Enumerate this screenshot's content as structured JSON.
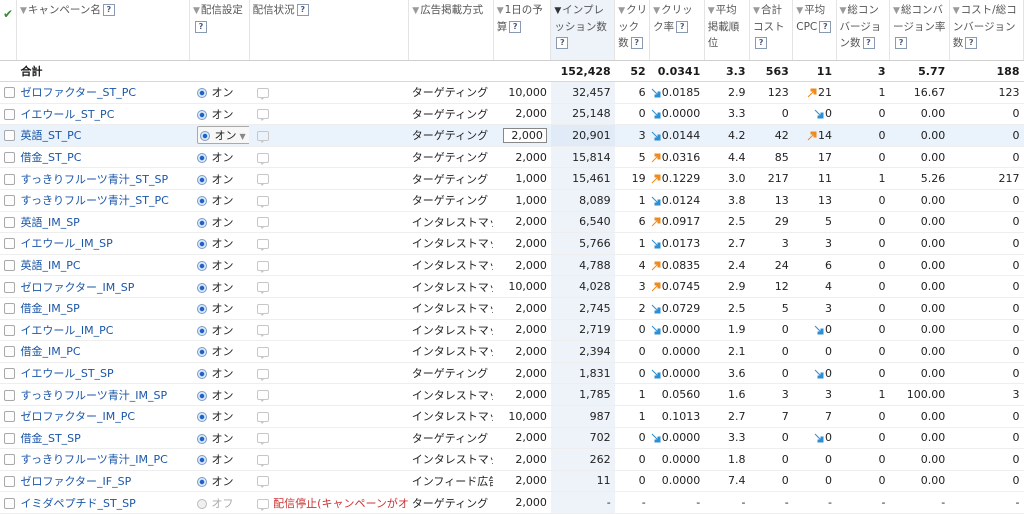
{
  "headers": {
    "campaign": "キャンペーン名",
    "setting": "配信設定",
    "status": "配信状況",
    "adtype": "広告掲載方式",
    "budget": "1日の予算",
    "imp": "インプレッション数",
    "click": "クリック数",
    "ctr": "クリック率",
    "pos": "平均掲載順位",
    "cost": "合計コスト",
    "cpc": "平均CPC",
    "conv": "総コンバージョン数",
    "convrate": "総コンバージョン率",
    "costconv": "コスト/総コンバージョン数",
    "help": "?"
  },
  "total": {
    "label": "合計",
    "imp": "152,428",
    "click": "52",
    "ctr": "0.0341",
    "pos": "3.3",
    "cost": "563",
    "cpc": "11",
    "conv": "3",
    "convrate": "5.77",
    "costconv": "188"
  },
  "rows": [
    {
      "name": "ゼロファクター_ST_PC",
      "on": "オン",
      "type": "ターゲティング",
      "budget": "10,000",
      "imp": "32,457",
      "click": "6",
      "ctr": "0.0185",
      "ctr_trend": "down",
      "pos": "2.9",
      "cost": "123",
      "cpc": "21",
      "cpc_trend": "up",
      "conv": "1",
      "convrate": "16.67",
      "costconv": "123"
    },
    {
      "name": "イエウール_ST_PC",
      "on": "オン",
      "type": "ターゲティング",
      "budget": "2,000",
      "imp": "25,148",
      "click": "0",
      "ctr": "0.0000",
      "ctr_trend": "down",
      "pos": "3.3",
      "cost": "0",
      "cpc": "0",
      "cpc_trend": "down",
      "conv": "0",
      "convrate": "0.00",
      "costconv": "0"
    },
    {
      "name": "英語_ST_PC",
      "on": "オン",
      "type": "ターゲティング",
      "budget": "2,000",
      "imp": "20,901",
      "click": "3",
      "ctr": "0.0144",
      "ctr_trend": "down",
      "pos": "4.2",
      "cost": "42",
      "cpc": "14",
      "cpc_trend": "up",
      "conv": "0",
      "convrate": "0.00",
      "costconv": "0",
      "editing": true
    },
    {
      "name": "借金_ST_PC",
      "on": "オン",
      "type": "ターゲティング",
      "budget": "2,000",
      "imp": "15,814",
      "click": "5",
      "ctr": "0.0316",
      "ctr_trend": "up",
      "pos": "4.4",
      "cost": "85",
      "cpc": "17",
      "cpc_trend": "",
      "conv": "0",
      "convrate": "0.00",
      "costconv": "0"
    },
    {
      "name": "すっきりフルーツ青汁_ST_SP",
      "on": "オン",
      "type": "ターゲティング",
      "budget": "1,000",
      "imp": "15,461",
      "click": "19",
      "ctr": "0.1229",
      "ctr_trend": "up",
      "pos": "3.0",
      "cost": "217",
      "cpc": "11",
      "cpc_trend": "",
      "conv": "1",
      "convrate": "5.26",
      "costconv": "217"
    },
    {
      "name": "すっきりフルーツ青汁_ST_PC",
      "on": "オン",
      "type": "ターゲティング",
      "budget": "1,000",
      "imp": "8,089",
      "click": "1",
      "ctr": "0.0124",
      "ctr_trend": "down",
      "pos": "3.8",
      "cost": "13",
      "cpc": "13",
      "cpc_trend": "",
      "conv": "0",
      "convrate": "0.00",
      "costconv": "0"
    },
    {
      "name": "英語_IM_SP",
      "on": "オン",
      "type": "インタレストマッチ",
      "budget": "2,000",
      "imp": "6,540",
      "click": "6",
      "ctr": "0.0917",
      "ctr_trend": "up",
      "pos": "2.5",
      "cost": "29",
      "cpc": "5",
      "cpc_trend": "",
      "conv": "0",
      "convrate": "0.00",
      "costconv": "0"
    },
    {
      "name": "イエウール_IM_SP",
      "on": "オン",
      "type": "インタレストマッチ",
      "budget": "2,000",
      "imp": "5,766",
      "click": "1",
      "ctr": "0.0173",
      "ctr_trend": "down",
      "pos": "2.7",
      "cost": "3",
      "cpc": "3",
      "cpc_trend": "",
      "conv": "0",
      "convrate": "0.00",
      "costconv": "0"
    },
    {
      "name": "英語_IM_PC",
      "on": "オン",
      "type": "インタレストマッチ",
      "budget": "2,000",
      "imp": "4,788",
      "click": "4",
      "ctr": "0.0835",
      "ctr_trend": "up",
      "pos": "2.4",
      "cost": "24",
      "cpc": "6",
      "cpc_trend": "",
      "conv": "0",
      "convrate": "0.00",
      "costconv": "0"
    },
    {
      "name": "ゼロファクター_IM_SP",
      "on": "オン",
      "type": "インタレストマッチ",
      "budget": "10,000",
      "imp": "4,028",
      "click": "3",
      "ctr": "0.0745",
      "ctr_trend": "up",
      "pos": "2.9",
      "cost": "12",
      "cpc": "4",
      "cpc_trend": "",
      "conv": "0",
      "convrate": "0.00",
      "costconv": "0"
    },
    {
      "name": "借金_IM_SP",
      "on": "オン",
      "type": "インタレストマッチ",
      "budget": "2,000",
      "imp": "2,745",
      "click": "2",
      "ctr": "0.0729",
      "ctr_trend": "down",
      "pos": "2.5",
      "cost": "5",
      "cpc": "3",
      "cpc_trend": "",
      "conv": "0",
      "convrate": "0.00",
      "costconv": "0"
    },
    {
      "name": "イエウール_IM_PC",
      "on": "オン",
      "type": "インタレストマッチ",
      "budget": "2,000",
      "imp": "2,719",
      "click": "0",
      "ctr": "0.0000",
      "ctr_trend": "down",
      "pos": "1.9",
      "cost": "0",
      "cpc": "0",
      "cpc_trend": "down",
      "conv": "0",
      "convrate": "0.00",
      "costconv": "0"
    },
    {
      "name": "借金_IM_PC",
      "on": "オン",
      "type": "インタレストマッチ",
      "budget": "2,000",
      "imp": "2,394",
      "click": "0",
      "ctr": "0.0000",
      "ctr_trend": "",
      "pos": "2.1",
      "cost": "0",
      "cpc": "0",
      "cpc_trend": "",
      "conv": "0",
      "convrate": "0.00",
      "costconv": "0"
    },
    {
      "name": "イエウール_ST_SP",
      "on": "オン",
      "type": "ターゲティング",
      "budget": "2,000",
      "imp": "1,831",
      "click": "0",
      "ctr": "0.0000",
      "ctr_trend": "down",
      "pos": "3.6",
      "cost": "0",
      "cpc": "0",
      "cpc_trend": "down",
      "conv": "0",
      "convrate": "0.00",
      "costconv": "0"
    },
    {
      "name": "すっきりフルーツ青汁_IM_SP",
      "on": "オン",
      "type": "インタレストマッチ",
      "budget": "2,000",
      "imp": "1,785",
      "click": "1",
      "ctr": "0.0560",
      "ctr_trend": "",
      "pos": "1.6",
      "cost": "3",
      "cpc": "3",
      "cpc_trend": "",
      "conv": "1",
      "convrate": "100.00",
      "costconv": "3"
    },
    {
      "name": "ゼロファクター_IM_PC",
      "on": "オン",
      "type": "インタレストマッチ",
      "budget": "10,000",
      "imp": "987",
      "click": "1",
      "ctr": "0.1013",
      "ctr_trend": "",
      "pos": "2.7",
      "cost": "7",
      "cpc": "7",
      "cpc_trend": "",
      "conv": "0",
      "convrate": "0.00",
      "costconv": "0"
    },
    {
      "name": "借金_ST_SP",
      "on": "オン",
      "type": "ターゲティング",
      "budget": "2,000",
      "imp": "702",
      "click": "0",
      "ctr": "0.0000",
      "ctr_trend": "down",
      "pos": "3.3",
      "cost": "0",
      "cpc": "0",
      "cpc_trend": "down",
      "conv": "0",
      "convrate": "0.00",
      "costconv": "0"
    },
    {
      "name": "すっきりフルーツ青汁_IM_PC",
      "on": "オン",
      "type": "インタレストマッチ",
      "budget": "2,000",
      "imp": "262",
      "click": "0",
      "ctr": "0.0000",
      "ctr_trend": "",
      "pos": "1.8",
      "cost": "0",
      "cpc": "0",
      "cpc_trend": "",
      "conv": "0",
      "convrate": "0.00",
      "costconv": "0"
    },
    {
      "name": "ゼロファクター_IF_SP",
      "on": "オン",
      "type": "インフィード広告",
      "budget": "2,000",
      "imp": "11",
      "click": "0",
      "ctr": "0.0000",
      "ctr_trend": "",
      "pos": "7.4",
      "cost": "0",
      "cpc": "0",
      "cpc_trend": "",
      "conv": "0",
      "convrate": "0.00",
      "costconv": "0"
    },
    {
      "name": "イミダペプチド_ST_SP",
      "on": "オフ",
      "type": "ターゲティング",
      "budget": "2,000",
      "imp": "-",
      "click": "-",
      "ctr": "-",
      "ctr_trend": "",
      "pos": "-",
      "cost": "-",
      "cpc": "-",
      "cpc_trend": "",
      "conv": "-",
      "convrate": "-",
      "costconv": "-",
      "status": "配信停止(キャンペーンがオフ)"
    }
  ],
  "colors": {
    "up": "#f08a1c",
    "down": "#2b8fd6",
    "link": "#1a56a8",
    "highlight": "#eaf2fb"
  }
}
